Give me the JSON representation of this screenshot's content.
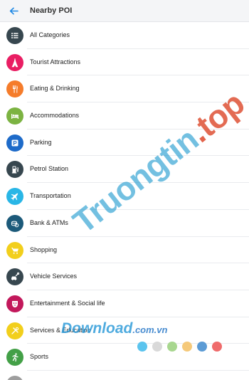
{
  "header": {
    "title": "Nearby POI",
    "back_icon": "arrow-left-icon",
    "accent": "#1e88e5"
  },
  "categories": [
    {
      "label": "All Categories",
      "icon": "list-icon",
      "color": "#37474f"
    },
    {
      "label": "Tourist Attractions",
      "icon": "eiffel-tower-icon",
      "color": "#e91e63"
    },
    {
      "label": "Eating & Drinking",
      "icon": "fork-knife-icon",
      "color": "#f57c2b"
    },
    {
      "label": "Accommodations",
      "icon": "bed-icon",
      "color": "#7cb342"
    },
    {
      "label": "Parking",
      "icon": "parking-icon",
      "color": "#1e6bc9"
    },
    {
      "label": "Petrol Station",
      "icon": "fuel-pump-icon",
      "color": "#37474f"
    },
    {
      "label": "Transportation",
      "icon": "airplane-icon",
      "color": "#29b6e6"
    },
    {
      "label": "Bank & ATMs",
      "icon": "coins-icon",
      "color": "#1c5a7a"
    },
    {
      "label": "Shopping",
      "icon": "shopping-cart-icon",
      "color": "#f2cf1c"
    },
    {
      "label": "Vehicle Services",
      "icon": "car-wrench-icon",
      "color": "#37474f"
    },
    {
      "label": "Entertainment & Social life",
      "icon": "theater-masks-icon",
      "color": "#c2185b"
    },
    {
      "label": "Services & Education",
      "icon": "tools-icon",
      "color": "#f2cf1c"
    },
    {
      "label": "Sports",
      "icon": "running-person-icon",
      "color": "#43a047"
    }
  ],
  "watermark": {
    "site_name": "Truongtin",
    "site_dot": ".",
    "site_tld": "top",
    "download_text": "Download",
    "download_suffix": ".com.vn",
    "dot_colors": [
      "#5bc4ee",
      "#d9d9d9",
      "#a8d78f",
      "#f5c97a",
      "#5b9bd5",
      "#ef6b6b"
    ]
  }
}
